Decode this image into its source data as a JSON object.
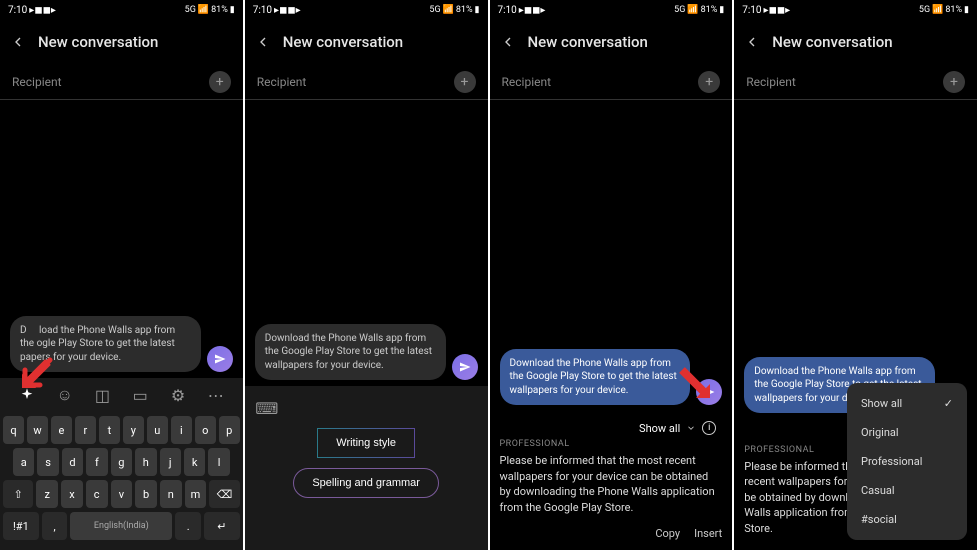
{
  "status": {
    "time": "7:10",
    "battery": "81%",
    "network": "5G"
  },
  "header": {
    "title": "New conversation"
  },
  "recipient": {
    "label": "Recipient"
  },
  "message": {
    "text_partial": "load the Phone Walls app from the ogle Play Store to get the latest papers for your device.",
    "text_full": "Download the Phone Walls app from the Google Play Store to get the latest wallpapers for your device.",
    "text_selected": "Download the Phone Walls app from the Google Play Store to get the latest wallpapers for your device."
  },
  "keyboard": {
    "row1": [
      "q",
      "w",
      "e",
      "r",
      "t",
      "y",
      "u",
      "i",
      "o",
      "p"
    ],
    "row2": [
      "a",
      "s",
      "d",
      "f",
      "g",
      "h",
      "j",
      "k",
      "l"
    ],
    "row3_mid": [
      "z",
      "x",
      "c",
      "v",
      "b",
      "n",
      "m"
    ],
    "shift": "⇧",
    "backspace": "⌫",
    "symbols": "!#1",
    "comma": ",",
    "space_label": "English(India)",
    "period": ".",
    "enter": "↵"
  },
  "suggestions": {
    "writing_style": "Writing style",
    "spelling_grammar": "Spelling and grammar"
  },
  "result": {
    "show_all": "Show all",
    "category": "Professional",
    "text": "Please be informed that the most recent wallpapers for your device can be obtained by downloading the Phone Walls application from the Google Play Store.",
    "text_truncated": "Please be informed that the most recent wallpapers for your device can be obtained by downloading the Phone Walls application from the Google Play Store.",
    "copy": "Copy",
    "insert": "Insert"
  },
  "dropdown": {
    "options": [
      "Show all",
      "Original",
      "Professional",
      "Casual",
      "#social"
    ],
    "selected": "Show all"
  }
}
